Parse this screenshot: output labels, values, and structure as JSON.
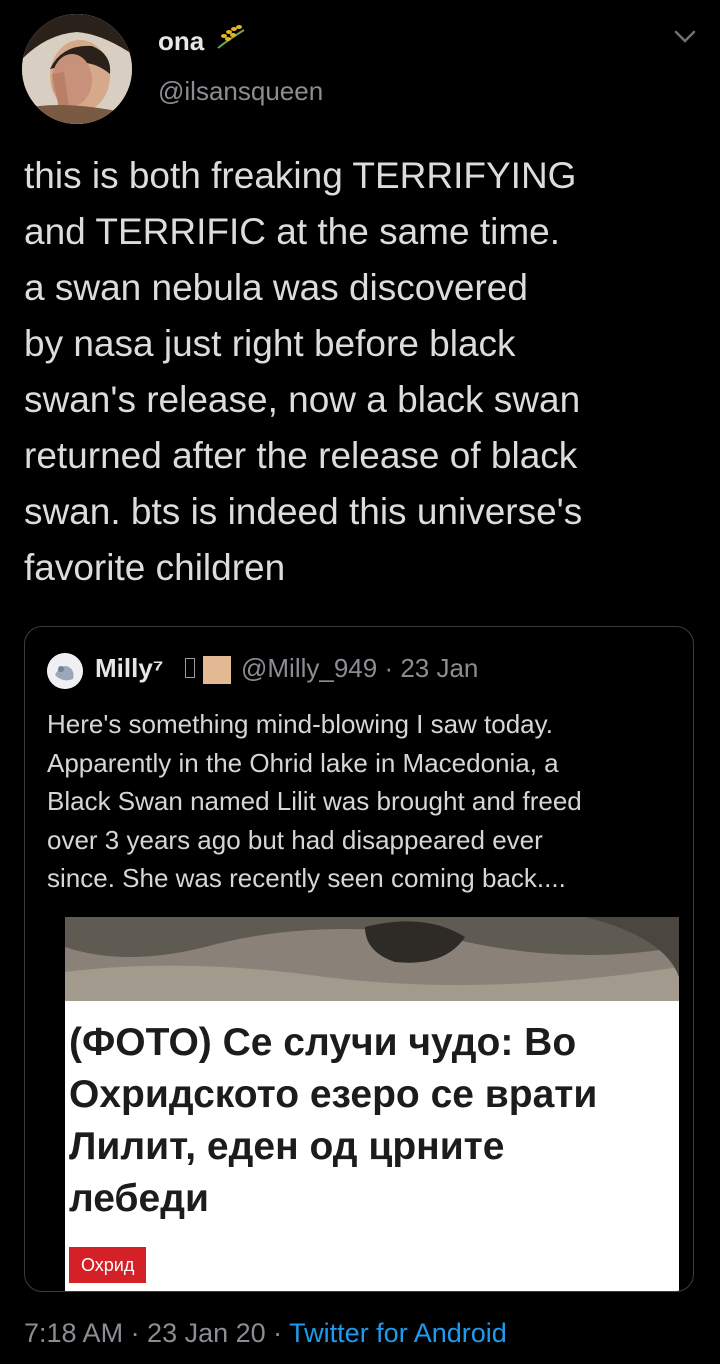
{
  "header": {
    "display_name": "ona",
    "name_emoji": "wheat-icon",
    "handle": "@ilsansqueen"
  },
  "tweet": {
    "text": "this is both freaking TERRIFYING\nand TERRIFIC at the same time.\na swan nebula was discovered\nby nasa just right before black\nswan's release, now a black swan\nreturned after the release of black\nswan. bts is indeed this universe's\nfavorite children"
  },
  "quote": {
    "name": "Milly⁷",
    "meta": "@Milly_949 · 23 Jan",
    "text": "Here's something mind-blowing I saw today.\nApparently in the Ohrid lake in Macedonia, a\nBlack Swan named Lilit was brought and freed\nover 3 years ago but had disappeared ever\nsince. She was recently seen coming back....",
    "article": {
      "title": "(ФОТО) Се случи чудо: Во\nОхридското езеро се врати\nЛилит, еден од црните\nлебеди",
      "tag": "Охрид"
    }
  },
  "footer": {
    "time_date": "7:18 AM · 23 Jan 20 · ",
    "source": "Twitter for Android"
  },
  "colors": {
    "background": "#000000",
    "link": "#1d9bf0",
    "tag": "#d42027"
  }
}
